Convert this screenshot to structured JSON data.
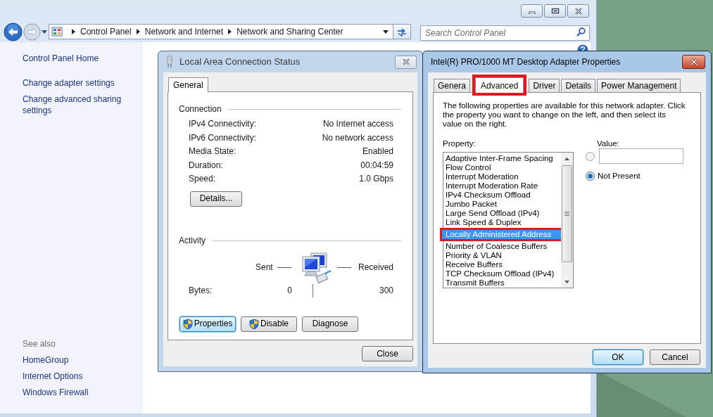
{
  "explorer": {
    "breadcrumb": [
      "Control Panel",
      "Network and Internet",
      "Network and Sharing Center"
    ],
    "search": {
      "placeholder": "Search Control Panel"
    },
    "sidebar": {
      "items": [
        "Control Panel Home",
        "Change adapter settings",
        "Change advanced sharing settings"
      ],
      "see_also": {
        "heading": "See also",
        "items": [
          "HomeGroup",
          "Internet Options",
          "Windows Firewall"
        ]
      }
    }
  },
  "status_dialog": {
    "title": "Local Area Connection Status",
    "tabs": [
      {
        "label": "General",
        "selected": true
      }
    ],
    "connection": {
      "heading": "Connection",
      "rows": [
        {
          "label": "IPv4 Connectivity:",
          "value": "No Internet access"
        },
        {
          "label": "IPv6 Connectivity:",
          "value": "No network access"
        },
        {
          "label": "Media State:",
          "value": "Enabled"
        },
        {
          "label": "Duration:",
          "value": "00:04:59"
        },
        {
          "label": "Speed:",
          "value": "1.0 Gbps"
        }
      ]
    },
    "details_button": "Details...",
    "activity": {
      "heading": "Activity",
      "sent_label": "Sent",
      "received_label": "Received",
      "bytes_label": "Bytes:",
      "bytes_sent": "0",
      "bytes_received": "300"
    },
    "buttons": [
      {
        "label": "Properties",
        "shield": true,
        "default": true
      },
      {
        "label": "Disable",
        "shield": true,
        "default": false
      },
      {
        "label": "Diagnose",
        "shield": false,
        "default": false
      }
    ],
    "close_button": "Close"
  },
  "properties_dialog": {
    "title": "Intel(R) PRO/1000 MT Desktop Adapter Properties",
    "tabs": [
      {
        "label": "Genera",
        "selected": false,
        "annotated": false
      },
      {
        "label": "Advanced",
        "selected": true,
        "annotated": true
      },
      {
        "label": "Driver",
        "selected": false,
        "annotated": false
      },
      {
        "label": "Details",
        "selected": false,
        "annotated": false
      },
      {
        "label": "Power Management",
        "selected": false,
        "annotated": false
      }
    ],
    "description": "The following properties are available for this network adapter. Click the property you want to change on the left, and then select its value on the right.",
    "property_label": "Property:",
    "properties": [
      {
        "label": "Adaptive Inter-Frame Spacing",
        "selected": false,
        "annotated": false
      },
      {
        "label": "Flow Control",
        "selected": false,
        "annotated": false
      },
      {
        "label": "Interrupt Moderation",
        "selected": false,
        "annotated": false
      },
      {
        "label": "Interrupt Moderation Rate",
        "selected": false,
        "annotated": false
      },
      {
        "label": "IPv4 Checksum Offload",
        "selected": false,
        "annotated": false
      },
      {
        "label": "Jumbo Packet",
        "selected": false,
        "annotated": false
      },
      {
        "label": "Large Send Offload (IPv4)",
        "selected": false,
        "annotated": false
      },
      {
        "label": "Link Speed & Duplex",
        "selected": false,
        "annotated": false
      },
      {
        "label": "Locally Administered Address",
        "selected": true,
        "annotated": true
      },
      {
        "label": "Number of Coalesce Buffers",
        "selected": false,
        "annotated": false
      },
      {
        "label": "Priority & VLAN",
        "selected": false,
        "annotated": false
      },
      {
        "label": "Receive Buffers",
        "selected": false,
        "annotated": false
      },
      {
        "label": "TCP Checksum Offload (IPv4)",
        "selected": false,
        "annotated": false
      },
      {
        "label": "Transmit Buffers",
        "selected": false,
        "annotated": false
      }
    ],
    "value_label": "Value:",
    "value_options": [
      {
        "kind": "text",
        "checked": false
      },
      {
        "kind": "choice",
        "label": "Not Present",
        "checked": true
      }
    ],
    "buttons": [
      {
        "label": "OK",
        "default": true
      },
      {
        "label": "Cancel",
        "default": false
      }
    ]
  }
}
